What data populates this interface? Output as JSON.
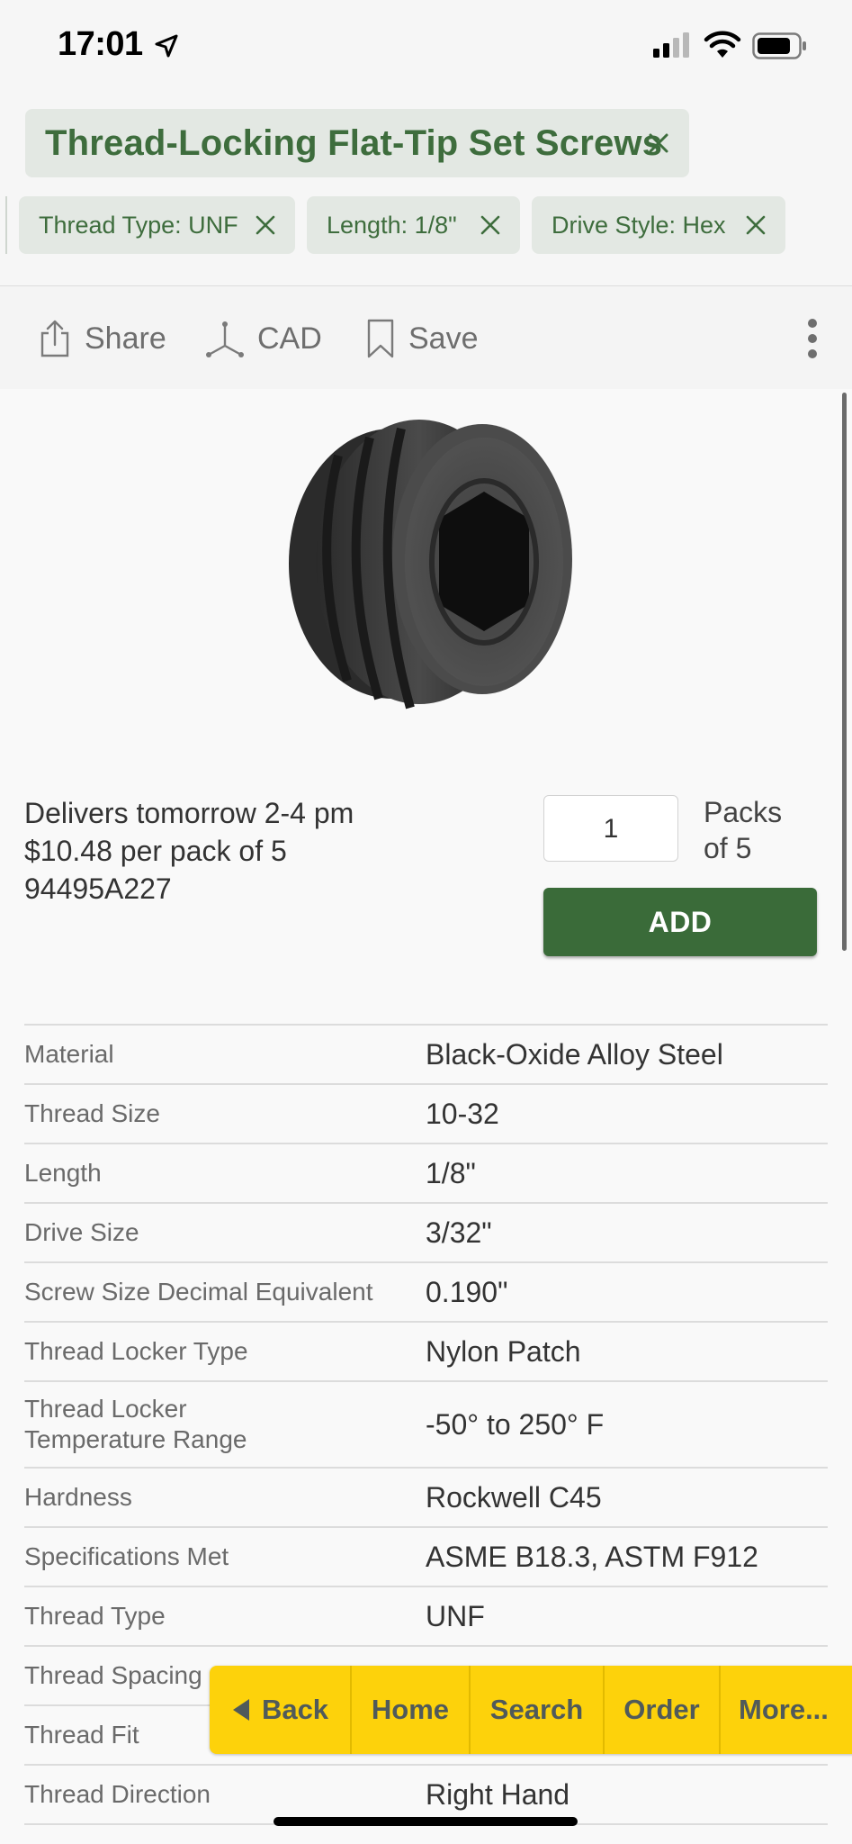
{
  "status_bar": {
    "time": "17:01"
  },
  "header": {
    "title_chip": "Thread-Locking Flat-Tip Set Screws",
    "filters": [
      {
        "label": "Thread Type: UNF"
      },
      {
        "label": "Length: 1/8\""
      },
      {
        "label": "Drive Style: Hex"
      }
    ]
  },
  "toolbar": {
    "share": "Share",
    "cad": "CAD",
    "save": "Save"
  },
  "product": {
    "delivery": "Delivers tomorrow 2-4 pm",
    "price": "$10.48 per pack of 5",
    "part_number": "94495A227",
    "quantity": "1",
    "packs_line1": "Packs",
    "packs_line2": "of 5",
    "add_label": "ADD"
  },
  "specs": [
    {
      "key": "Material",
      "value": "Black-Oxide Alloy Steel"
    },
    {
      "key": "Thread Size",
      "value": "10-32"
    },
    {
      "key": "Length",
      "value": "1/8\""
    },
    {
      "key": "Drive Size",
      "value": "3/32\""
    },
    {
      "key": "Screw Size Decimal Equivalent",
      "value": "0.190\""
    },
    {
      "key": "Thread Locker Type",
      "value": "Nylon Patch"
    },
    {
      "key": "Thread Locker Temperature Range",
      "value": "-50° to 250° F"
    },
    {
      "key": "Hardness",
      "value": "Rockwell C45"
    },
    {
      "key": "Specifications Met",
      "value": "ASME B18.3, ASTM F912"
    },
    {
      "key": "Thread Type",
      "value": "UNF"
    },
    {
      "key": "Thread Spacing",
      "value": ""
    },
    {
      "key": "Thread Fit",
      "value": ""
    },
    {
      "key": "Thread Direction",
      "value": "Right Hand"
    }
  ],
  "bottom_nav": {
    "back": "Back",
    "home": "Home",
    "search": "Search",
    "order": "Order",
    "more": "More..."
  },
  "colors": {
    "brand_green": "#3a6b39",
    "chip_bg": "#e3e8e3",
    "chip_text": "#3e6d3d",
    "nav_yellow": "#fdd20b"
  }
}
